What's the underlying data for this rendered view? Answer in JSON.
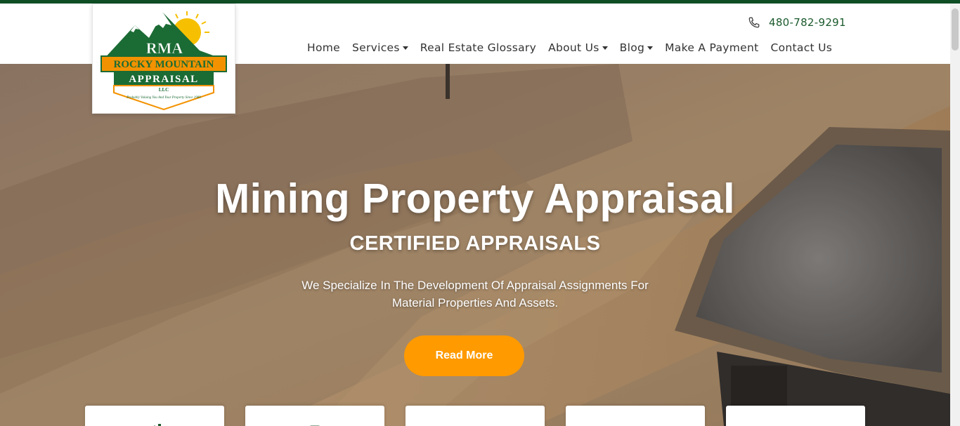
{
  "brand": {
    "logo_initials": "RMA",
    "logo_name_line1": "ROCKY MOUNTAIN",
    "logo_name_line2": "APPRAISAL",
    "logo_suffix": "LLC",
    "logo_tagline": "Probably Valuing You And Your Property Since 1989",
    "colors": {
      "green": "#1b6b34",
      "orange": "#f39200",
      "yellow": "#f6c000"
    }
  },
  "header": {
    "phone": "480-782-9291",
    "phone_icon": "phone-icon"
  },
  "nav": {
    "items": [
      {
        "label": "Home",
        "dropdown": false
      },
      {
        "label": "Services",
        "dropdown": true
      },
      {
        "label": "Real Estate Glossary",
        "dropdown": false
      },
      {
        "label": "About Us",
        "dropdown": true
      },
      {
        "label": "Blog",
        "dropdown": true
      },
      {
        "label": "Make A Payment",
        "dropdown": false
      },
      {
        "label": "Contact Us",
        "dropdown": false
      }
    ]
  },
  "hero": {
    "title": "Mining Property Appraisal",
    "subtitle": "CERTIFIED APPRAISALS",
    "description": "We Specialize In The Development Of Appraisal Assignments For Material Properties And Assets.",
    "cta_label": "Read More",
    "cta_color": "#ff9a00"
  },
  "feature_cards": {
    "icons": [
      "home-icon",
      "document-icon",
      "leaf-icon",
      "hand-icon",
      "chart-icon"
    ],
    "icon_color": "#1b5a2d"
  }
}
